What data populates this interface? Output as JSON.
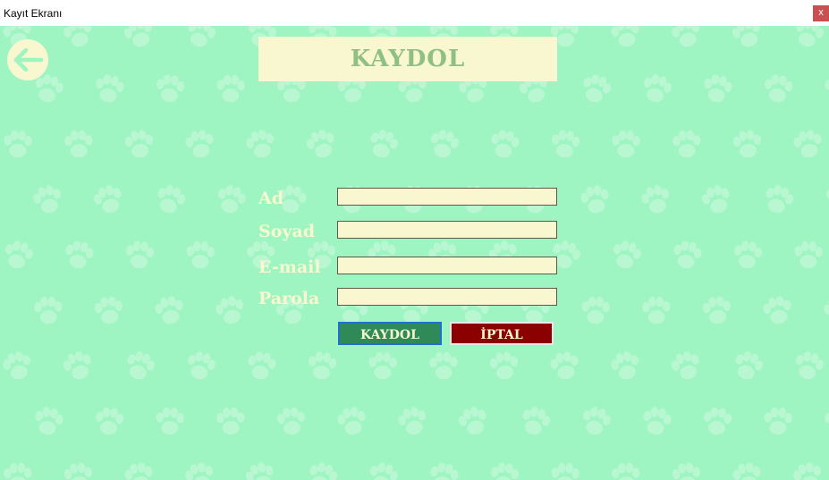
{
  "window": {
    "title": "Kayıt Ekranı",
    "close_label": "x"
  },
  "header": {
    "title": "KAYDOL"
  },
  "back_button": {
    "icon": "arrow-left-icon"
  },
  "form": {
    "fields": [
      {
        "label": "Ad",
        "value": "",
        "placeholder": ""
      },
      {
        "label": "Soyad",
        "value": "",
        "placeholder": ""
      },
      {
        "label": "E-mail",
        "value": "",
        "placeholder": ""
      },
      {
        "label": "Parola",
        "value": "",
        "placeholder": ""
      }
    ],
    "save_label": "KAYDOL",
    "cancel_label": "İPTAL"
  },
  "colors": {
    "background": "#9ff5c2",
    "cream": "#f9f7cf",
    "title_text": "#8fbf83",
    "save_button": "#2f8a57",
    "cancel_button": "#8b0000"
  }
}
